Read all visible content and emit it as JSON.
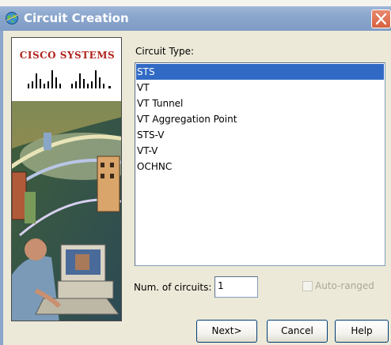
{
  "window": {
    "title": "Circuit Creation"
  },
  "branding": {
    "company": "Cisco Systems"
  },
  "form": {
    "circuit_type_label": "Circuit Type:",
    "circuit_types": [
      {
        "label": "STS",
        "selected": true
      },
      {
        "label": "VT",
        "selected": false
      },
      {
        "label": "VT Tunnel",
        "selected": false
      },
      {
        "label": "VT Aggregation Point",
        "selected": false
      },
      {
        "label": "STS-V",
        "selected": false
      },
      {
        "label": "VT-V",
        "selected": false
      },
      {
        "label": "OCHNC",
        "selected": false
      }
    ],
    "num_circuits_label": "Num. of circuits:",
    "num_circuits_value": "1",
    "auto_ranged_label": "Auto-ranged",
    "auto_ranged_checked": false,
    "auto_ranged_enabled": false
  },
  "buttons": {
    "next_label": "Next>",
    "cancel_label": "Cancel",
    "help_label": "Help"
  },
  "colors": {
    "title_bar": "#8ba6cc",
    "selection": "#316ac5",
    "dialog_bg": "#ece9d8",
    "close_button": "#d6603f",
    "cisco_red": "#b0241c"
  },
  "icons": {
    "app": "globe-icon",
    "close": "close-icon"
  }
}
